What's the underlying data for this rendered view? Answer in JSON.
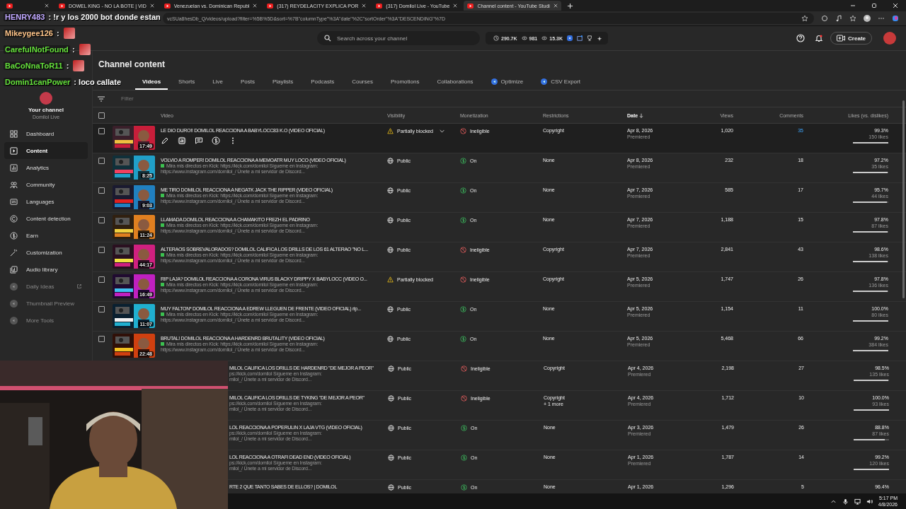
{
  "browser_tabs": [
    {
      "selected": false
    },
    {
      "title": "DOWEL KING - NO LA BOTE | VID",
      "selected": false
    },
    {
      "title": "Venezuelan vs. Dominican Republ",
      "selected": false
    },
    {
      "title": "(317) REYDELACITY EXPLICA POR",
      "selected": false
    },
    {
      "title": "(317) Domilol Live - YouTube",
      "selected": false
    },
    {
      "title": "Channel content - YouTube Studi",
      "selected": true
    }
  ],
  "address_bar": {
    "url": "vcSUa8hesDb_Q/videos/upload?filter=%5B%5D&sort=%7B\"columnType\"%3A\"date\"%2C\"sortOrder\"%3A\"DESCENDING\"%7D"
  },
  "header": {
    "search_placeholder": "Search across your channel",
    "stats": [
      "290.7K",
      "981",
      "15.3K"
    ],
    "create_label": "Create"
  },
  "sidebar": {
    "channel_label": "Your channel",
    "channel_name": "Domilol Live",
    "items": [
      {
        "label": "Dashboard",
        "selected": false,
        "kind": "nav"
      },
      {
        "label": "Content",
        "selected": true,
        "kind": "nav"
      },
      {
        "label": "Analytics",
        "selected": false,
        "kind": "nav"
      },
      {
        "label": "Community",
        "selected": false,
        "kind": "nav"
      },
      {
        "label": "Languages",
        "selected": false,
        "kind": "nav"
      },
      {
        "label": "Content detection",
        "selected": false,
        "kind": "nav"
      },
      {
        "label": "Earn",
        "selected": false,
        "kind": "nav"
      },
      {
        "label": "Customization",
        "selected": false,
        "kind": "nav"
      },
      {
        "label": "Audio library",
        "selected": false,
        "kind": "nav"
      },
      {
        "label": "Daily Ideas",
        "selected": false,
        "kind": "extension",
        "external": true
      },
      {
        "label": "Thumbnail Preview",
        "selected": false,
        "kind": "extension",
        "external": false
      },
      {
        "label": "More Tools",
        "selected": false,
        "kind": "extension",
        "external": false
      }
    ]
  },
  "page_title": "Channel content",
  "content_tabs": [
    {
      "label": "Videos",
      "selected": true,
      "kind": "tab"
    },
    {
      "label": "Shorts",
      "selected": false,
      "kind": "tab"
    },
    {
      "label": "Live",
      "selected": false,
      "kind": "tab"
    },
    {
      "label": "Posts",
      "selected": false,
      "kind": "tab"
    },
    {
      "label": "Playlists",
      "selected": false,
      "kind": "tab"
    },
    {
      "label": "Podcasts",
      "selected": false,
      "kind": "tab"
    },
    {
      "label": "Courses",
      "selected": false,
      "kind": "tab"
    },
    {
      "label": "Promotions",
      "selected": false,
      "kind": "tab"
    },
    {
      "label": "Collaborations",
      "selected": false,
      "kind": "tab"
    },
    {
      "label": "Optimize",
      "selected": false,
      "kind": "extension"
    },
    {
      "label": "CSV Export",
      "selected": false,
      "kind": "extension"
    }
  ],
  "filter": {
    "placeholder": "Filter"
  },
  "table": {
    "select_all": {
      "checked": false
    },
    "columns": [
      {
        "label": "Video",
        "sorted": false
      },
      {
        "label": "Visibility",
        "sorted": false
      },
      {
        "label": "Monetization",
        "sorted": false
      },
      {
        "label": "Restrictions",
        "sorted": false
      },
      {
        "label": "Date",
        "sorted": true
      },
      {
        "label": "Views",
        "sorted": false
      },
      {
        "label": "Comments",
        "sorted": false
      },
      {
        "label": "Likes (vs. dislikes)",
        "sorted": false
      }
    ],
    "rows": [
      {
        "hovered": true,
        "checked": false,
        "duration": "17:49",
        "title": "LE DIO DURO!! DOMILOL REACCIONA A BABYLOCC83 K.O (VIDEO OFICIAL)",
        "visibility": {
          "kind": "blocked",
          "label": "Partially blocked"
        },
        "monetization": {
          "kind": "ineligible",
          "label": "Ineligible"
        },
        "restrictions": [
          "Copyright"
        ],
        "date": "Apr 8, 2026",
        "date_note": "Premiered",
        "views": "1,020",
        "comments": "35",
        "likes_pct": "99.3%",
        "likes": "150 likes",
        "level": 0.993
      },
      {
        "hovered": false,
        "checked": false,
        "duration": "8:25",
        "title": "VOLVIO A ROMPER! DOMILOL REACCIONA A MEMOATR MUY LOCO (VIDEO OFICIAL)",
        "desc": [
          "Mira mis directos en Kick: https://kick.com/domilol  Sígueme en Instagram:",
          "https://www.instagram.com/domilol_/  Únete a mi servidor de Discord..."
        ],
        "visibility": {
          "kind": "public",
          "label": "Public"
        },
        "monetization": {
          "kind": "on",
          "label": "On"
        },
        "restrictions": [
          "None"
        ],
        "date": "Apr 8, 2026",
        "date_note": "Premiered",
        "views": "232",
        "comments": "18",
        "likes_pct": "97.2%",
        "likes": "35 likes",
        "level": 0.972
      },
      {
        "hovered": false,
        "checked": false,
        "duration": "9:03",
        "title": "ME TIRO  DOMILOL REACCIONA A NEGATK JACK THE RIPPER (VIDEO OFICIAL)",
        "desc": [
          "Mira mis directos en Kick: https://kick.com/domilol  Sígueme en Instagram:",
          "https://www.instagram.com/domilol_/  Únete a mi servidor de Discord..."
        ],
        "visibility": {
          "kind": "public",
          "label": "Public"
        },
        "monetization": {
          "kind": "on",
          "label": "On"
        },
        "restrictions": [
          "None"
        ],
        "date": "Apr 7, 2026",
        "date_note": "Premiered",
        "views": "585",
        "comments": "17",
        "likes_pct": "95.7%",
        "likes": "44 likes",
        "level": 0.957
      },
      {
        "hovered": false,
        "checked": false,
        "duration": "11:24",
        "title": "LLAMADA  DOMILOL REACCIONA A CHAMAKITO FREZH EL PADRINO",
        "desc": [
          "Mira mis directos en Kick: https://kick.com/domilol  Sígueme en Instagram:",
          "https://www.instagram.com/domilol_/  Únete a mi servidor de Discord..."
        ],
        "visibility": {
          "kind": "public",
          "label": "Public"
        },
        "monetization": {
          "kind": "on",
          "label": "On"
        },
        "restrictions": [
          "None"
        ],
        "date": "Apr 7, 2026",
        "date_note": "Premiered",
        "views": "1,188",
        "comments": "15",
        "likes_pct": "97.8%",
        "likes": "87 likes",
        "level": 0.978
      },
      {
        "hovered": false,
        "checked": false,
        "duration": "44:17",
        "title": "ALTERAOS SOBREVALORADOS? DOMILOL CALIFICA LOS DRILLS DE LOS 61 ALTERAO \"NO L...",
        "desc": [
          "Mira mis directos en Kick: https://kick.com/domilol  Sígueme en Instagram:",
          "https://www.instagram.com/domilol_/  Únete a mi servidor de Discord..."
        ],
        "visibility": {
          "kind": "public",
          "label": "Public"
        },
        "monetization": {
          "kind": "ineligible",
          "label": "Ineligible"
        },
        "restrictions": [
          "Copyright"
        ],
        "date": "Apr 7, 2026",
        "date_note": "Premiered",
        "views": "2,841",
        "comments": "43",
        "likes_pct": "98.6%",
        "likes": "138 likes",
        "level": 0.986
      },
      {
        "hovered": false,
        "checked": false,
        "duration": "16:49",
        "title": "RIP LAJA?  DOMILOL REACCIONA A CORONA VIRUS BLACKY DRIPPY X BABYLOCC (VIDEO O...",
        "desc": [
          "Mira mis directos en Kick: https://kick.com/domilol  Sígueme en Instagram:",
          "https://www.instagram.com/domilol_/  Únete a mi servidor de Discord..."
        ],
        "visibility": {
          "kind": "blocked",
          "label": "Partially blocked"
        },
        "monetization": {
          "kind": "ineligible",
          "label": "Ineligible"
        },
        "restrictions": [
          "Copyright"
        ],
        "date": "Apr 5, 2026",
        "date_note": "Premiered",
        "views": "1,747",
        "comments": "26",
        "likes_pct": "97.8%",
        "likes": "136 likes",
        "level": 0.978
      },
      {
        "hovered": false,
        "checked": false,
        "duration": "11:07",
        "title": "MUY FALTON*  DOMILOL REACCIONA A EDREW LLEGUEN DE FRENTE (VIDEO OFICIAL) rip...",
        "desc": [
          "Mira mis directos en Kick: https://kick.com/domilol  Sígueme en Instagram:",
          "https://www.instagram.com/domilol_/  Únete a mi servidor de Discord..."
        ],
        "visibility": {
          "kind": "public",
          "label": "Public"
        },
        "monetization": {
          "kind": "on",
          "label": "On"
        },
        "restrictions": [
          "None"
        ],
        "date": "Apr 5, 2026",
        "date_note": "Premiered",
        "views": "1,154",
        "comments": "11",
        "likes_pct": "100.0%",
        "likes": "80 likes",
        "level": 1.0
      },
      {
        "hovered": false,
        "checked": false,
        "duration": "22:48",
        "title": "BRUTAL!  DOMILOL REACCIONA A HARDENRD BRUTALITY (VIDEO OFICIAL)",
        "desc": [
          "Mira mis directos en Kick: https://kick.com/domilol  Sígueme en Instagram:",
          "https://www.instagram.com/domilol_/  Únete a mi servidor de Discord..."
        ],
        "visibility": {
          "kind": "public",
          "label": "Public"
        },
        "monetization": {
          "kind": "on",
          "label": "On"
        },
        "restrictions": [
          "None"
        ],
        "date": "Apr 5, 2026",
        "date_note": "Premiered",
        "views": "5,468",
        "comments": "66",
        "likes_pct": "99.2%",
        "likes": "384 likes",
        "level": 0.992
      },
      {
        "hovered": false,
        "title": "MILOL CALIFICA LOS DRILLS DE HARDENRD \"DE MEJOR A PEOR\"",
        "desc": [
          "ps://kick.com/domilol  Sígueme en Instagram:",
          "milol_/  Únete a mi servidor de Discord..."
        ],
        "visibility": {
          "kind": "public",
          "label": "Public"
        },
        "monetization": {
          "kind": "ineligible",
          "label": "Ineligible"
        },
        "restrictions": [
          "Copyright"
        ],
        "date": "Apr 4, 2026",
        "date_note": "Premiered",
        "views": "2,198",
        "comments": "27",
        "likes_pct": "98.5%",
        "likes": "135 likes",
        "level": 0.985
      },
      {
        "hovered": false,
        "title": "MILOL CALIFICA LOS DRILLS DE TYKING \"DE MEJOR A PEOR\"",
        "desc": [
          "ps://kick.com/domilol  Sígueme en Instagram:",
          "milol_/  Únete a mi servidor de Discord..."
        ],
        "visibility": {
          "kind": "public",
          "label": "Public"
        },
        "monetization": {
          "kind": "ineligible",
          "label": "Ineligible"
        },
        "restrictions": [
          "Copyright",
          "+ 1 more"
        ],
        "date": "Apr 4, 2026",
        "date_note": "Premiered",
        "views": "1,712",
        "comments": "10",
        "likes_pct": "100.0%",
        "likes": "93 likes",
        "level": 1.0
      },
      {
        "hovered": false,
        "title": "LOL REACCIONA A POPERULIN X LAJA VTG (VIDEO OFICIAL)",
        "desc": [
          "ps://kick.com/domilol  Sígueme en Instagram:",
          "milol_/  Únete a mi servidor de Discord..."
        ],
        "visibility": {
          "kind": "public",
          "label": "Public"
        },
        "monetization": {
          "kind": "on",
          "label": "On"
        },
        "restrictions": [
          "None"
        ],
        "date": "Apr 3, 2026",
        "date_note": "Premiered",
        "views": "1,479",
        "comments": "26",
        "likes_pct": "88.8%",
        "likes": "87 likes",
        "level": 0.888
      },
      {
        "hovered": false,
        "title": "LOL REACCIONA A OTRAFI DEAD END (VIDEO OFICIAL)",
        "desc": [
          "ps://kick.com/domilol  Sígueme en Instagram:",
          "milol_/  Únete a mi servidor de Discord..."
        ],
        "visibility": {
          "kind": "public",
          "label": "Public"
        },
        "monetization": {
          "kind": "on",
          "label": "On"
        },
        "restrictions": [
          "None"
        ],
        "date": "Apr 1, 2026",
        "date_note": "Premiered",
        "views": "1,787",
        "comments": "14",
        "likes_pct": "99.2%",
        "likes": "120 likes",
        "level": 0.992
      },
      {
        "hovered": false,
        "title": "RTE 2 QUE TANTO SABES DE ELLOS? | DOMILOL",
        "visibility": {
          "kind": "public",
          "label": "Public"
        },
        "monetization": {
          "kind": "on",
          "label": "On"
        },
        "restrictions": [
          "None"
        ],
        "date": "Apr 1, 2026",
        "views": "1,296",
        "comments": "5",
        "likes_pct": "96.4%"
      }
    ]
  },
  "taskbar": {
    "time": "5:17 PM",
    "date": "4/8/2026"
  },
  "chat": [
    {
      "user": "HENRY483",
      "color": "#c0a8ff",
      "text": ": !r y los 2000 bot donde estan",
      "emote": false
    },
    {
      "user": "Mikeygee126",
      "color": "#ffc58a",
      "text": ":",
      "emote": true
    },
    {
      "user": "CarefulNotFound",
      "color": "#66e33c",
      "text": ":",
      "emote": true
    },
    {
      "user": "BaCoNnaToR11",
      "color": "#66e33c",
      "text": ":",
      "emote": true
    },
    {
      "user": "Domin1canPower",
      "color": "#66e33c",
      "text": ": loco callate",
      "emote": false
    }
  ]
}
